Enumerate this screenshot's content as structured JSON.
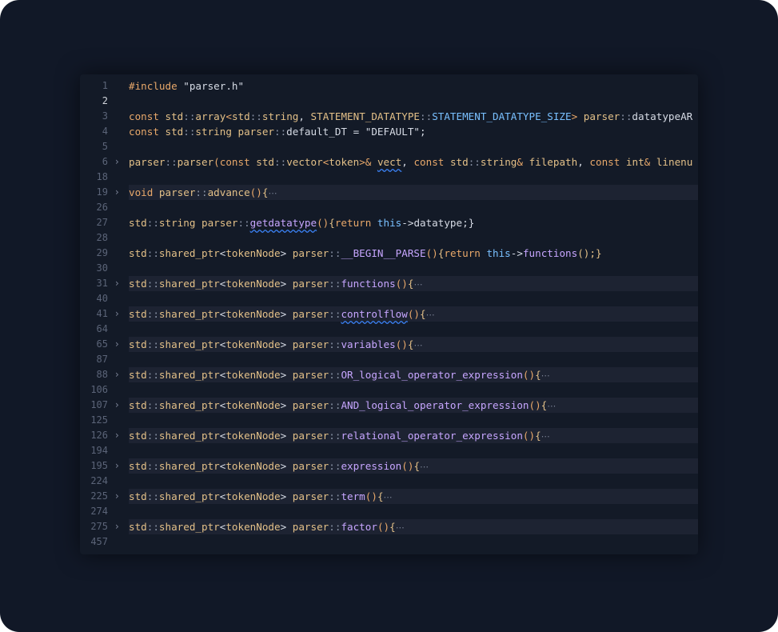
{
  "editor": {
    "active_line": "2",
    "lines": [
      {
        "num": "1",
        "folded": false,
        "tokens": [
          [
            "#include ",
            "o"
          ],
          [
            "\"parser.h\"",
            "l"
          ]
        ]
      },
      {
        "num": "2",
        "folded": false,
        "tokens": []
      },
      {
        "num": "3",
        "folded": false,
        "tokens": [
          [
            "const ",
            "o"
          ],
          [
            "std",
            "y"
          ],
          [
            "::",
            "g"
          ],
          [
            "array",
            "y"
          ],
          [
            "<",
            "o"
          ],
          [
            "std",
            "y"
          ],
          [
            "::",
            "g"
          ],
          [
            "string",
            "y"
          ],
          [
            ", ",
            "l"
          ],
          [
            "STATEMENT_DATATYPE",
            "y"
          ],
          [
            "::",
            "g"
          ],
          [
            "STATEMENT_DATATYPE_SIZE",
            "b"
          ],
          [
            "> ",
            "o"
          ],
          [
            "parser",
            "y"
          ],
          [
            "::",
            "g"
          ],
          [
            "datatypeAR",
            "l"
          ]
        ]
      },
      {
        "num": "4",
        "folded": false,
        "tokens": [
          [
            "const ",
            "o"
          ],
          [
            "std",
            "y"
          ],
          [
            "::",
            "g"
          ],
          [
            "string ",
            "y"
          ],
          [
            "parser",
            "y"
          ],
          [
            "::",
            "g"
          ],
          [
            "default_DT ",
            "l"
          ],
          [
            "= ",
            "l"
          ],
          [
            "\"DEFAULT\"",
            "l"
          ],
          [
            ";",
            "l"
          ]
        ]
      },
      {
        "num": "5",
        "folded": false,
        "tokens": []
      },
      {
        "num": "6",
        "folded": false,
        "chevron": true,
        "tokens": [
          [
            "parser",
            "y"
          ],
          [
            "::",
            "g"
          ],
          [
            "parser",
            "y"
          ],
          [
            "(",
            "o"
          ],
          [
            "const ",
            "o"
          ],
          [
            "std",
            "y"
          ],
          [
            "::",
            "g"
          ],
          [
            "vector",
            "y"
          ],
          [
            "<",
            "o"
          ],
          [
            "token",
            "y"
          ],
          [
            ">& ",
            "o"
          ],
          [
            "vect",
            "ys"
          ],
          [
            ", ",
            "l"
          ],
          [
            "const ",
            "o"
          ],
          [
            "std",
            "y"
          ],
          [
            "::",
            "g"
          ],
          [
            "string",
            "y"
          ],
          [
            "& ",
            "o"
          ],
          [
            "filepath",
            "y"
          ],
          [
            ", ",
            "l"
          ],
          [
            "const ",
            "o"
          ],
          [
            "int",
            "y"
          ],
          [
            "& ",
            "o"
          ],
          [
            "linenu",
            "y"
          ]
        ]
      },
      {
        "num": "18",
        "folded": false,
        "tokens": []
      },
      {
        "num": "19",
        "folded": true,
        "chevron": true,
        "ellipsis": true,
        "tokens": [
          [
            "void ",
            "o"
          ],
          [
            "parser",
            "y"
          ],
          [
            "::",
            "g"
          ],
          [
            "advance",
            "y"
          ],
          [
            "()",
            "o"
          ],
          [
            "{",
            "y"
          ]
        ]
      },
      {
        "num": "26",
        "folded": false,
        "tokens": []
      },
      {
        "num": "27",
        "folded": false,
        "tokens": [
          [
            "std",
            "y"
          ],
          [
            "::",
            "g"
          ],
          [
            "string ",
            "y"
          ],
          [
            "parser",
            "y"
          ],
          [
            "::",
            "g"
          ],
          [
            "getdatatype",
            "ps"
          ],
          [
            "()",
            "o"
          ],
          [
            "{",
            "y"
          ],
          [
            "return ",
            "o"
          ],
          [
            "this",
            "b"
          ],
          [
            "->",
            "l"
          ],
          [
            "datatype",
            "l"
          ],
          [
            ";}",
            "l"
          ]
        ]
      },
      {
        "num": "28",
        "folded": false,
        "tokens": []
      },
      {
        "num": "29",
        "folded": false,
        "tokens": [
          [
            "std",
            "y"
          ],
          [
            "::",
            "g"
          ],
          [
            "shared_ptr",
            "y"
          ],
          [
            "<",
            "l"
          ],
          [
            "tokenNode",
            "y"
          ],
          [
            "> ",
            "l"
          ],
          [
            "parser",
            "y"
          ],
          [
            "::",
            "g"
          ],
          [
            "__BEGIN__PARSE",
            "p"
          ],
          [
            "()",
            "o"
          ],
          [
            "{",
            "y"
          ],
          [
            "return ",
            "o"
          ],
          [
            "this",
            "b"
          ],
          [
            "->",
            "l"
          ],
          [
            "functions",
            "p"
          ],
          [
            "();}",
            "y"
          ]
        ]
      },
      {
        "num": "30",
        "folded": false,
        "tokens": []
      },
      {
        "num": "31",
        "folded": true,
        "chevron": true,
        "ellipsis": true,
        "tokens": [
          [
            "std",
            "y"
          ],
          [
            "::",
            "g"
          ],
          [
            "shared_ptr",
            "y"
          ],
          [
            "<",
            "l"
          ],
          [
            "tokenNode",
            "y"
          ],
          [
            "> ",
            "l"
          ],
          [
            "parser",
            "y"
          ],
          [
            "::",
            "g"
          ],
          [
            "functions",
            "p"
          ],
          [
            "()",
            "o"
          ],
          [
            "{",
            "y"
          ]
        ]
      },
      {
        "num": "40",
        "folded": false,
        "tokens": []
      },
      {
        "num": "41",
        "folded": true,
        "chevron": true,
        "ellipsis": true,
        "tokens": [
          [
            "std",
            "y"
          ],
          [
            "::",
            "g"
          ],
          [
            "shared_ptr",
            "y"
          ],
          [
            "<",
            "l"
          ],
          [
            "tokenNode",
            "y"
          ],
          [
            "> ",
            "l"
          ],
          [
            "parser",
            "y"
          ],
          [
            "::",
            "g"
          ],
          [
            "controlflow",
            "ps"
          ],
          [
            "()",
            "o"
          ],
          [
            "{",
            "y"
          ]
        ]
      },
      {
        "num": "64",
        "folded": false,
        "tokens": []
      },
      {
        "num": "65",
        "folded": true,
        "chevron": true,
        "ellipsis": true,
        "tokens": [
          [
            "std",
            "y"
          ],
          [
            "::",
            "g"
          ],
          [
            "shared_ptr",
            "y"
          ],
          [
            "<",
            "l"
          ],
          [
            "tokenNode",
            "y"
          ],
          [
            "> ",
            "l"
          ],
          [
            "parser",
            "y"
          ],
          [
            "::",
            "g"
          ],
          [
            "variables",
            "p"
          ],
          [
            "()",
            "o"
          ],
          [
            "{",
            "y"
          ]
        ]
      },
      {
        "num": "87",
        "folded": false,
        "tokens": []
      },
      {
        "num": "88",
        "folded": true,
        "chevron": true,
        "ellipsis": true,
        "tokens": [
          [
            "std",
            "y"
          ],
          [
            "::",
            "g"
          ],
          [
            "shared_ptr",
            "y"
          ],
          [
            "<",
            "l"
          ],
          [
            "tokenNode",
            "y"
          ],
          [
            "> ",
            "l"
          ],
          [
            "parser",
            "y"
          ],
          [
            "::",
            "g"
          ],
          [
            "OR_logical_operator_expression",
            "p"
          ],
          [
            "()",
            "o"
          ],
          [
            "{",
            "y"
          ]
        ]
      },
      {
        "num": "106",
        "folded": false,
        "tokens": []
      },
      {
        "num": "107",
        "folded": true,
        "chevron": true,
        "ellipsis": true,
        "tokens": [
          [
            "std",
            "y"
          ],
          [
            "::",
            "g"
          ],
          [
            "shared_ptr",
            "y"
          ],
          [
            "<",
            "l"
          ],
          [
            "tokenNode",
            "y"
          ],
          [
            "> ",
            "l"
          ],
          [
            "parser",
            "y"
          ],
          [
            "::",
            "g"
          ],
          [
            "AND_logical_operator_expression",
            "p"
          ],
          [
            "()",
            "o"
          ],
          [
            "{",
            "y"
          ]
        ]
      },
      {
        "num": "125",
        "folded": false,
        "tokens": []
      },
      {
        "num": "126",
        "folded": true,
        "chevron": true,
        "ellipsis": true,
        "tokens": [
          [
            "std",
            "y"
          ],
          [
            "::",
            "g"
          ],
          [
            "shared_ptr",
            "y"
          ],
          [
            "<",
            "l"
          ],
          [
            "tokenNode",
            "y"
          ],
          [
            "> ",
            "l"
          ],
          [
            "parser",
            "y"
          ],
          [
            "::",
            "g"
          ],
          [
            "relational_operator_expression",
            "p"
          ],
          [
            "()",
            "o"
          ],
          [
            "{",
            "y"
          ]
        ]
      },
      {
        "num": "194",
        "folded": false,
        "tokens": []
      },
      {
        "num": "195",
        "folded": true,
        "chevron": true,
        "ellipsis": true,
        "tokens": [
          [
            "std",
            "y"
          ],
          [
            "::",
            "g"
          ],
          [
            "shared_ptr",
            "y"
          ],
          [
            "<",
            "l"
          ],
          [
            "tokenNode",
            "y"
          ],
          [
            "> ",
            "l"
          ],
          [
            "parser",
            "y"
          ],
          [
            "::",
            "g"
          ],
          [
            "expression",
            "p"
          ],
          [
            "()",
            "o"
          ],
          [
            "{",
            "y"
          ]
        ]
      },
      {
        "num": "224",
        "folded": false,
        "tokens": []
      },
      {
        "num": "225",
        "folded": true,
        "chevron": true,
        "ellipsis": true,
        "tokens": [
          [
            "std",
            "y"
          ],
          [
            "::",
            "g"
          ],
          [
            "shared_ptr",
            "y"
          ],
          [
            "<",
            "l"
          ],
          [
            "tokenNode",
            "y"
          ],
          [
            "> ",
            "l"
          ],
          [
            "parser",
            "y"
          ],
          [
            "::",
            "g"
          ],
          [
            "term",
            "p"
          ],
          [
            "()",
            "o"
          ],
          [
            "{",
            "y"
          ]
        ]
      },
      {
        "num": "274",
        "folded": false,
        "tokens": []
      },
      {
        "num": "275",
        "folded": true,
        "chevron": true,
        "ellipsis": true,
        "tokens": [
          [
            "std",
            "y"
          ],
          [
            "::",
            "g"
          ],
          [
            "shared_ptr",
            "y"
          ],
          [
            "<",
            "l"
          ],
          [
            "tokenNode",
            "y"
          ],
          [
            "> ",
            "l"
          ],
          [
            "parser",
            "y"
          ],
          [
            "::",
            "g"
          ],
          [
            "factor",
            "p"
          ],
          [
            "()",
            "o"
          ],
          [
            "{",
            "y"
          ]
        ]
      },
      {
        "num": "457",
        "folded": false,
        "tokens": []
      }
    ]
  },
  "icons": {
    "fold_chevron": "chevron-right-icon",
    "folded_ellipsis": "ellipsis-icon"
  },
  "glyphs": {
    "chevron": "›",
    "ellipsis": "⋯"
  },
  "colors": {
    "frame_bg": "#111827",
    "editor_bg": "#131a27",
    "fold_highlight": "#1d2332",
    "keyword": "#e8a86a",
    "type": "#e3c088",
    "constant": "#79c0ff",
    "function": "#c7a6ff",
    "text": "#d6dbe5",
    "line_number": "#5b6478"
  }
}
